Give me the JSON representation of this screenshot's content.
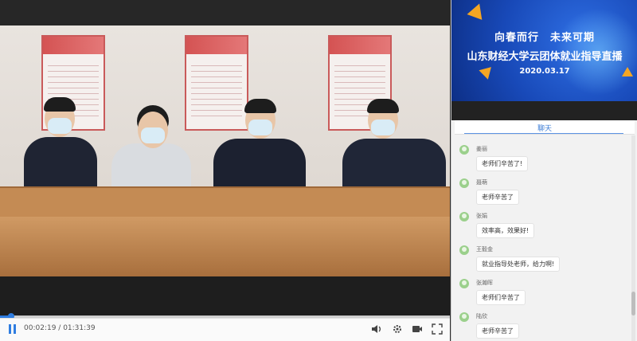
{
  "player": {
    "current_time": "00:02:19",
    "total_time": "01:31:39",
    "time_separator": " / ",
    "progress": 0.025
  },
  "banner": {
    "slogan": "向春而行　未来可期",
    "title": "山东财经大学云团体就业指导直播",
    "date": "2020.03.17"
  },
  "chat": {
    "tab_label": "聊天",
    "messages": [
      {
        "user": "姜丽",
        "text": "老师们辛苦了!"
      },
      {
        "user": "聂萌",
        "text": "老师辛苦了"
      },
      {
        "user": "张娟",
        "text": "效率高，效果好!"
      },
      {
        "user": "王毅金",
        "text": "就业指导处老师，给力啊!"
      },
      {
        "user": "张瀚晖",
        "text": "老师们辛苦了"
      },
      {
        "user": "陆欣",
        "text": "老师辛苦了"
      }
    ]
  },
  "icons": {
    "pause": "pause-icon",
    "volume": "volume-icon",
    "settings": "settings-icon",
    "camera": "camera-icon",
    "fullscreen": "fullscreen-icon",
    "avatar": "user-avatar-icon"
  },
  "colors": {
    "accent": "#2f7de1",
    "banner_blue": "#1849b8",
    "highlight": "#f5a623"
  }
}
